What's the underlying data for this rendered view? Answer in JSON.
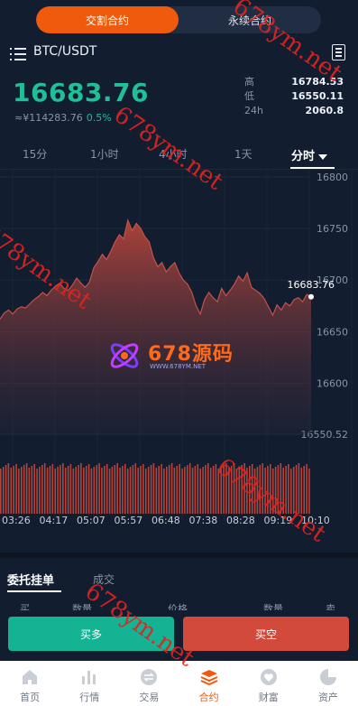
{
  "top_switch": {
    "options": [
      "交割合约",
      "永续合约"
    ],
    "active_index": 0
  },
  "header": {
    "pair": "BTC/USDT",
    "menu_icon": "menu-icon",
    "doc_icon": "document-icon"
  },
  "ticker": {
    "price": "16683.76",
    "cny": "≈¥114283.76",
    "change_pct": "0.5%",
    "high_label": "高",
    "high": "16784.53",
    "low_label": "低",
    "low": "16550.11",
    "vol_label": "24h",
    "vol": "2060.8"
  },
  "intervals": {
    "items": [
      "15分",
      "1小时",
      "4小时",
      "1天",
      "分时"
    ],
    "active_index": 4
  },
  "chart_data": {
    "type": "area",
    "y_ticks": [
      "16800",
      "16750",
      "16700",
      "16650",
      "16600",
      "16550.52"
    ],
    "x_ticks": [
      "03:26",
      "04:17",
      "05:07",
      "05:57",
      "06:48",
      "07:38",
      "08:28",
      "09:19",
      "10:10"
    ],
    "ylim": [
      16550.52,
      16800
    ],
    "last_price_label": "16683.76",
    "series": [
      {
        "values": [
          16662,
          16668,
          16671,
          16667,
          16672,
          16674,
          16673,
          16677,
          16681,
          16684,
          16688,
          16685,
          16690,
          16694,
          16697,
          16692,
          16690,
          16695,
          16702,
          16697,
          16693,
          16698,
          16712,
          16718,
          16725,
          16720,
          16728,
          16737,
          16744,
          16740,
          16758,
          16748,
          16755,
          16750,
          16742,
          16737,
          16722,
          16713,
          16717,
          16708,
          16713,
          16717,
          16707,
          16700,
          16696,
          16688,
          16675,
          16667,
          16681,
          16688,
          16683,
          16679,
          16692,
          16685,
          16690,
          16696,
          16704,
          16699,
          16707,
          16693,
          16690,
          16687,
          16682,
          16674,
          16666,
          16676,
          16671,
          16678,
          16675,
          16681,
          16683,
          16679,
          16686,
          16683.76
        ]
      }
    ],
    "volume_bars": 120
  },
  "watermarks": [
    "678ym.net",
    "678ym.net",
    "678ym.net",
    "678ym.net",
    "678ym.net",
    "678ym.net",
    "678ym.net"
  ],
  "logo": {
    "text": "678源码",
    "sub": "WWW.678YM.NET"
  },
  "orders": {
    "tabs": [
      "委托挂单",
      "成交"
    ],
    "columns": [
      "买",
      "数量",
      "价格",
      "数量",
      "卖"
    ]
  },
  "actions": {
    "buy": "买多",
    "sell": "买空"
  },
  "tabbar": {
    "items": [
      {
        "label": "首页",
        "icon": "home-icon"
      },
      {
        "label": "行情",
        "icon": "bar-chart-icon"
      },
      {
        "label": "交易",
        "icon": "exchange-icon"
      },
      {
        "label": "合约",
        "icon": "stack-icon"
      },
      {
        "label": "财富",
        "icon": "heart-icon"
      },
      {
        "label": "资产",
        "icon": "pie-chart-icon"
      }
    ],
    "active_index": 3
  },
  "colors": {
    "accent": "#f05a0c",
    "up": "#1fbf98",
    "down": "#d24a3c",
    "bg": "#131d30"
  }
}
